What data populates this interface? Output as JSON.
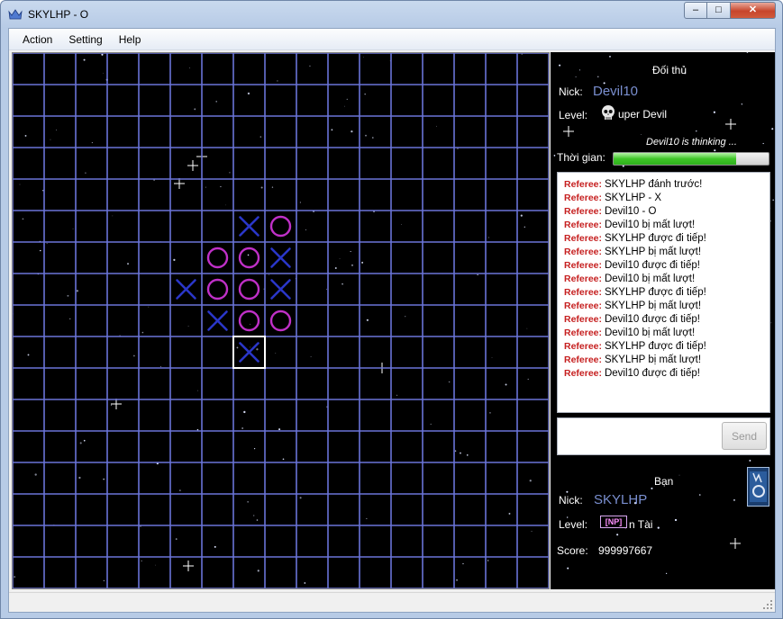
{
  "window": {
    "title": "SKYLHP - O",
    "min_glyph": "–",
    "max_glyph": "□",
    "close_glyph": "✕"
  },
  "menu": [
    "Action",
    "Setting",
    "Help"
  ],
  "board": {
    "cols": 17,
    "rows": 17,
    "line_color": "#6a74d8",
    "x_color": "#2a36c8",
    "o_color": "#c030c8",
    "moves": [
      {
        "mark": "X",
        "col": 7,
        "row": 5
      },
      {
        "mark": "O",
        "col": 8,
        "row": 5
      },
      {
        "mark": "O",
        "col": 6,
        "row": 6
      },
      {
        "mark": "O",
        "col": 7,
        "row": 6
      },
      {
        "mark": "X",
        "col": 8,
        "row": 6
      },
      {
        "mark": "X",
        "col": 5,
        "row": 7
      },
      {
        "mark": "O",
        "col": 6,
        "row": 7
      },
      {
        "mark": "O",
        "col": 7,
        "row": 7
      },
      {
        "mark": "X",
        "col": 8,
        "row": 7
      },
      {
        "mark": "X",
        "col": 6,
        "row": 8
      },
      {
        "mark": "O",
        "col": 7,
        "row": 8
      },
      {
        "mark": "O",
        "col": 8,
        "row": 8
      },
      {
        "mark": "X",
        "col": 7,
        "row": 9
      }
    ],
    "last_move": {
      "col": 7,
      "row": 9
    }
  },
  "opponent": {
    "heading": "Đối thủ",
    "nick_label": "Nick:",
    "nick": "Devil10",
    "level_label": "Level:",
    "level_icon": "skull-icon",
    "level": "uper Devil",
    "status": "Devil10 is thinking ..."
  },
  "timer": {
    "label": "Thời gian:",
    "fraction": 0.79,
    "color": "#3fc628"
  },
  "chat": {
    "speaker": "Referee:",
    "speaker_color": "#c62020",
    "messages": [
      "SKYLHP đánh trước!",
      "SKYLHP - X",
      "Devil10 - O",
      "Devil10 bị mất lượt!",
      "SKYLHP được đi tiếp!",
      "SKYLHP bị mất lượt!",
      "Devil10 được đi tiếp!",
      "Devil10 bị mất lượt!",
      "SKYLHP được đi tiếp!",
      "SKYLHP bị mất lượt!",
      "Devil10 được đi tiếp!",
      "Devil10 bị mất lượt!",
      "SKYLHP được đi tiếp!",
      "SKYLHP bị mất lượt!",
      "Devil10 được đi tiếp!"
    ],
    "input_value": "",
    "send_label": "Send"
  },
  "me": {
    "heading": "Bạn",
    "nick_label": "Nick:",
    "nick": "SKYLHP",
    "level_label": "Level:",
    "level_badge": "[NP]",
    "level": "n Tài",
    "score_label": "Score:",
    "score": "999997667"
  }
}
